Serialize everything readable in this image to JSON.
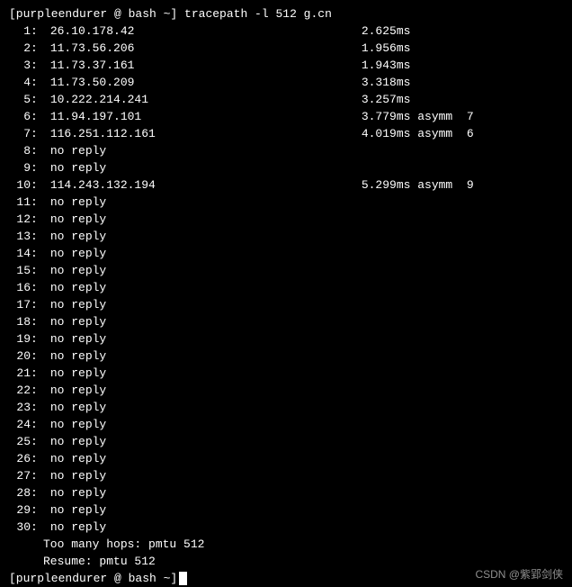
{
  "prompt": {
    "user_host": "[purpleendurer @ bash ~]",
    "command": "tracepath -l 512 g.cn"
  },
  "hops": [
    {
      "n": "1",
      "host": "26.10.178.42",
      "rtt": "2.625ms"
    },
    {
      "n": "2",
      "host": "11.73.56.206",
      "rtt": "1.956ms"
    },
    {
      "n": "3",
      "host": "11.73.37.161",
      "rtt": "1.943ms"
    },
    {
      "n": "4",
      "host": "11.73.50.209",
      "rtt": "3.318ms"
    },
    {
      "n": "5",
      "host": "10.222.214.241",
      "rtt": "3.257ms"
    },
    {
      "n": "6",
      "host": "11.94.197.101",
      "rtt": "3.779ms asymm  7"
    },
    {
      "n": "7",
      "host": "116.251.112.161",
      "rtt": "4.019ms asymm  6"
    },
    {
      "n": "8",
      "host": "no reply",
      "rtt": ""
    },
    {
      "n": "9",
      "host": "no reply",
      "rtt": ""
    },
    {
      "n": "10",
      "host": "114.243.132.194",
      "rtt": "5.299ms asymm  9"
    },
    {
      "n": "11",
      "host": "no reply",
      "rtt": ""
    },
    {
      "n": "12",
      "host": "no reply",
      "rtt": ""
    },
    {
      "n": "13",
      "host": "no reply",
      "rtt": ""
    },
    {
      "n": "14",
      "host": "no reply",
      "rtt": ""
    },
    {
      "n": "15",
      "host": "no reply",
      "rtt": ""
    },
    {
      "n": "16",
      "host": "no reply",
      "rtt": ""
    },
    {
      "n": "17",
      "host": "no reply",
      "rtt": ""
    },
    {
      "n": "18",
      "host": "no reply",
      "rtt": ""
    },
    {
      "n": "19",
      "host": "no reply",
      "rtt": ""
    },
    {
      "n": "20",
      "host": "no reply",
      "rtt": ""
    },
    {
      "n": "21",
      "host": "no reply",
      "rtt": ""
    },
    {
      "n": "22",
      "host": "no reply",
      "rtt": ""
    },
    {
      "n": "23",
      "host": "no reply",
      "rtt": ""
    },
    {
      "n": "24",
      "host": "no reply",
      "rtt": ""
    },
    {
      "n": "25",
      "host": "no reply",
      "rtt": ""
    },
    {
      "n": "26",
      "host": "no reply",
      "rtt": ""
    },
    {
      "n": "27",
      "host": "no reply",
      "rtt": ""
    },
    {
      "n": "28",
      "host": "no reply",
      "rtt": ""
    },
    {
      "n": "29",
      "host": "no reply",
      "rtt": ""
    },
    {
      "n": "30",
      "host": "no reply",
      "rtt": ""
    }
  ],
  "messages": {
    "too_many": "Too many hops: pmtu 512",
    "resume": "Resume: pmtu 512"
  },
  "prompt2": {
    "user_host": "[purpleendurer @ bash ~]"
  },
  "watermark": "CSDN @紫郢剑侠"
}
